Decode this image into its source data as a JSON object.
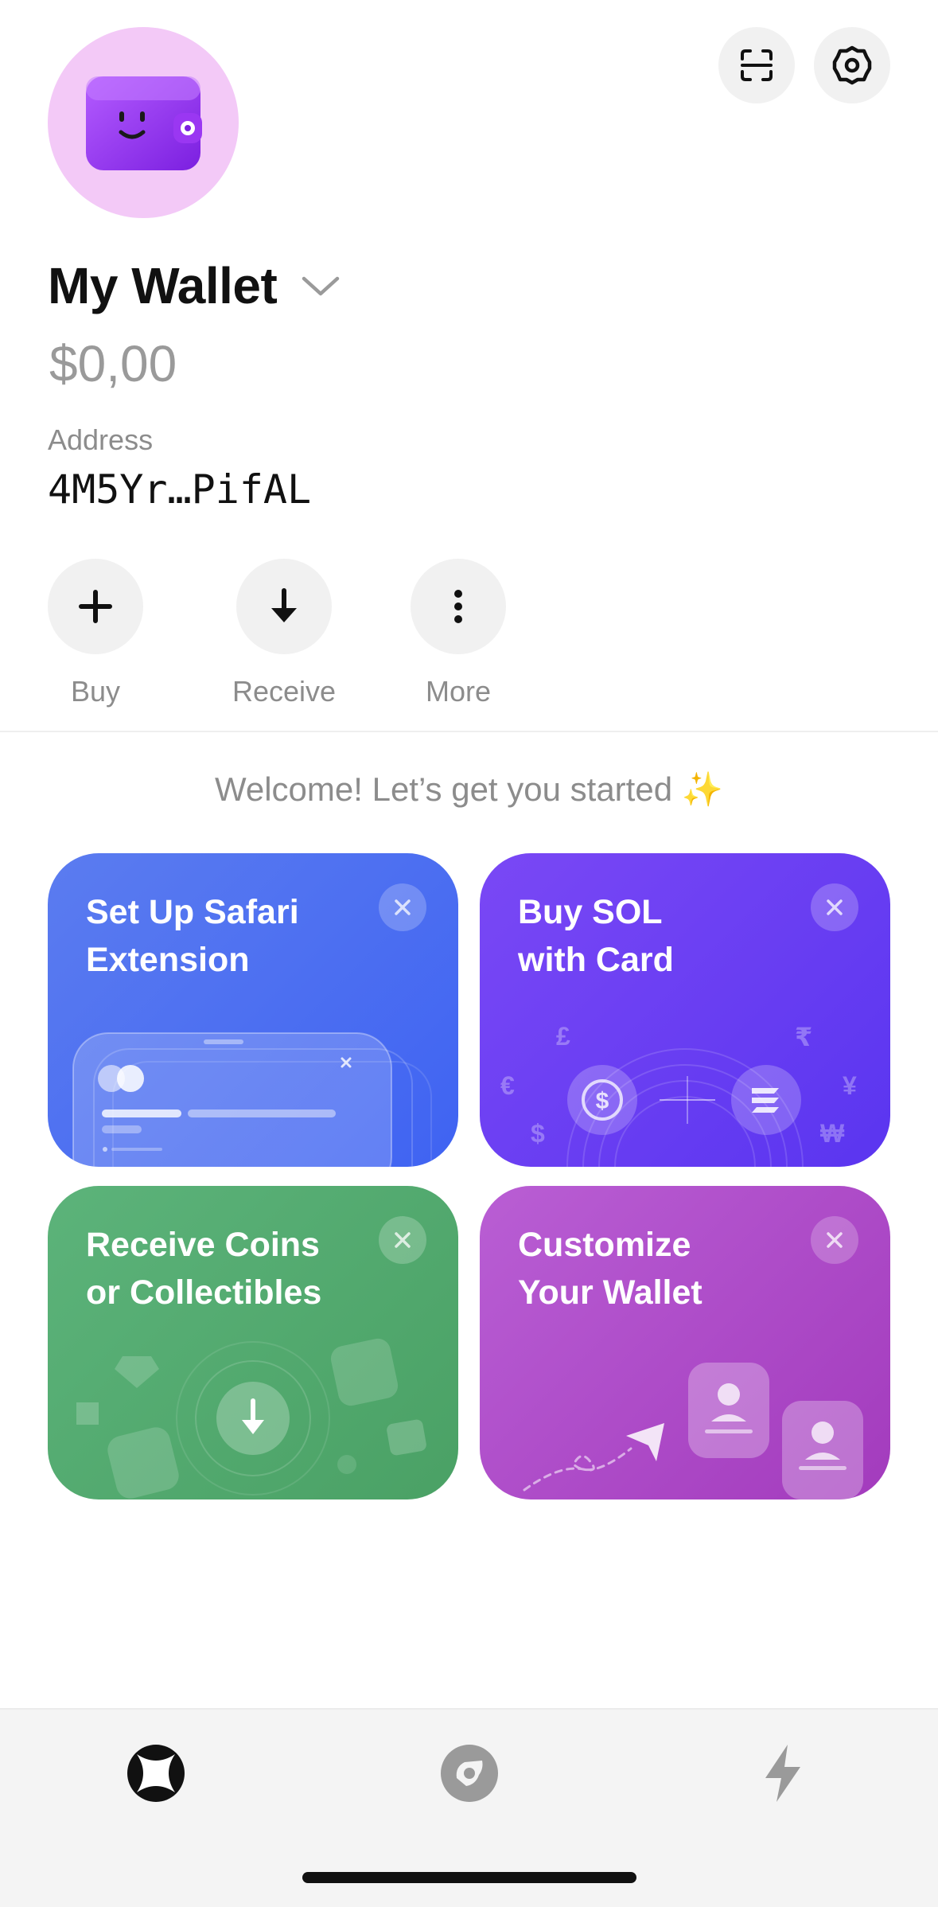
{
  "header": {
    "wallet_name": "My Wallet",
    "balance": "$0,00",
    "address_label": "Address",
    "address_value": "4M5Yr…PifAL"
  },
  "actions": [
    {
      "label": "Buy",
      "icon": "plus-icon"
    },
    {
      "label": "Receive",
      "icon": "arrow-down-icon"
    },
    {
      "label": "More",
      "icon": "more-vertical-icon"
    }
  ],
  "welcome": "Welcome! Let’s get you started ✨",
  "cards": [
    {
      "title": "Set Up Safari\nExtension",
      "color": "#4a6ff2"
    },
    {
      "title": "Buy SOL\nwith Card",
      "color": "#6a3ef3"
    },
    {
      "title": "Receive Coins\nor Collectibles",
      "color": "#52aa6e"
    },
    {
      "title": "Customize\nYour Wallet",
      "color": "#ae4cc9"
    }
  ],
  "card_art": {
    "currency_symbols": [
      "£",
      "₹",
      "€",
      "¥",
      "$",
      "₩"
    ]
  },
  "tabs": [
    {
      "name": "home",
      "icon": "home-icon",
      "active": true
    },
    {
      "name": "explore",
      "icon": "compass-icon",
      "active": false
    },
    {
      "name": "activity",
      "icon": "lightning-icon",
      "active": false
    }
  ],
  "colors": {
    "avatar_bg": "#f3c9f7",
    "wallet_purple": "#9b3df0",
    "text_primary": "#111111",
    "text_secondary": "#8c8c8c"
  }
}
